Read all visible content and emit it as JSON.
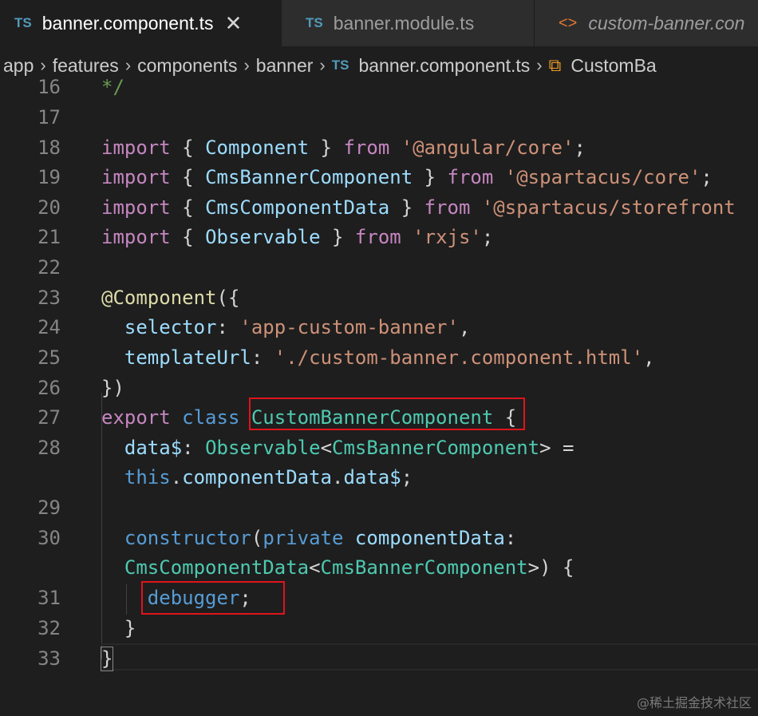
{
  "tabs": [
    {
      "icon": "TS",
      "label": "banner.component.ts",
      "close": "✕"
    },
    {
      "icon": "TS",
      "label": "banner.module.ts"
    },
    {
      "icon": "<>",
      "label": "custom-banner.con"
    }
  ],
  "breadcrumb": {
    "items": [
      "app",
      "features",
      "components",
      "banner"
    ],
    "file_icon": "TS",
    "file": "banner.component.ts",
    "symbol": "CustomBa"
  },
  "gutter": [
    "16",
    "17",
    "18",
    "19",
    "20",
    "21",
    "22",
    "23",
    "24",
    "25",
    "26",
    "27",
    "28",
    "",
    "29",
    "30",
    "",
    "31",
    "32",
    "33"
  ],
  "code": {
    "l16": "*/",
    "imports": [
      {
        "kw": "import",
        "name": "Component",
        "from": "from",
        "mod": "'@angular/core'"
      },
      {
        "kw": "import",
        "name": "CmsBannerComponent",
        "from": "from",
        "mod": "'@spartacus/core'"
      },
      {
        "kw": "import",
        "name": "CmsComponentData",
        "from": "from",
        "mod": "'@spartacus/storefront"
      },
      {
        "kw": "import",
        "name": "Observable",
        "from": "from",
        "mod": "'rxjs'"
      }
    ],
    "decorator": "@Component",
    "selector_key": "selector",
    "selector_val": "'app-custom-banner'",
    "template_key": "templateUrl",
    "template_val": "'./custom-banner.component.html'",
    "export_kw": "export",
    "class_kw": "class",
    "class_name": "CustomBannerComponent",
    "data_var": "data$",
    "observable": "Observable",
    "cms_banner": "CmsBannerComponent",
    "this_kw": "this",
    "component_data": "componentData",
    "data_prop": "data$",
    "constructor": "constructor",
    "private_kw": "private",
    "param": "componentData",
    "cms_component_data": "CmsComponentData",
    "cms_banner2": "CmsBannerComponent",
    "debugger": "debugger"
  },
  "watermark": "@稀土掘金技术社区"
}
